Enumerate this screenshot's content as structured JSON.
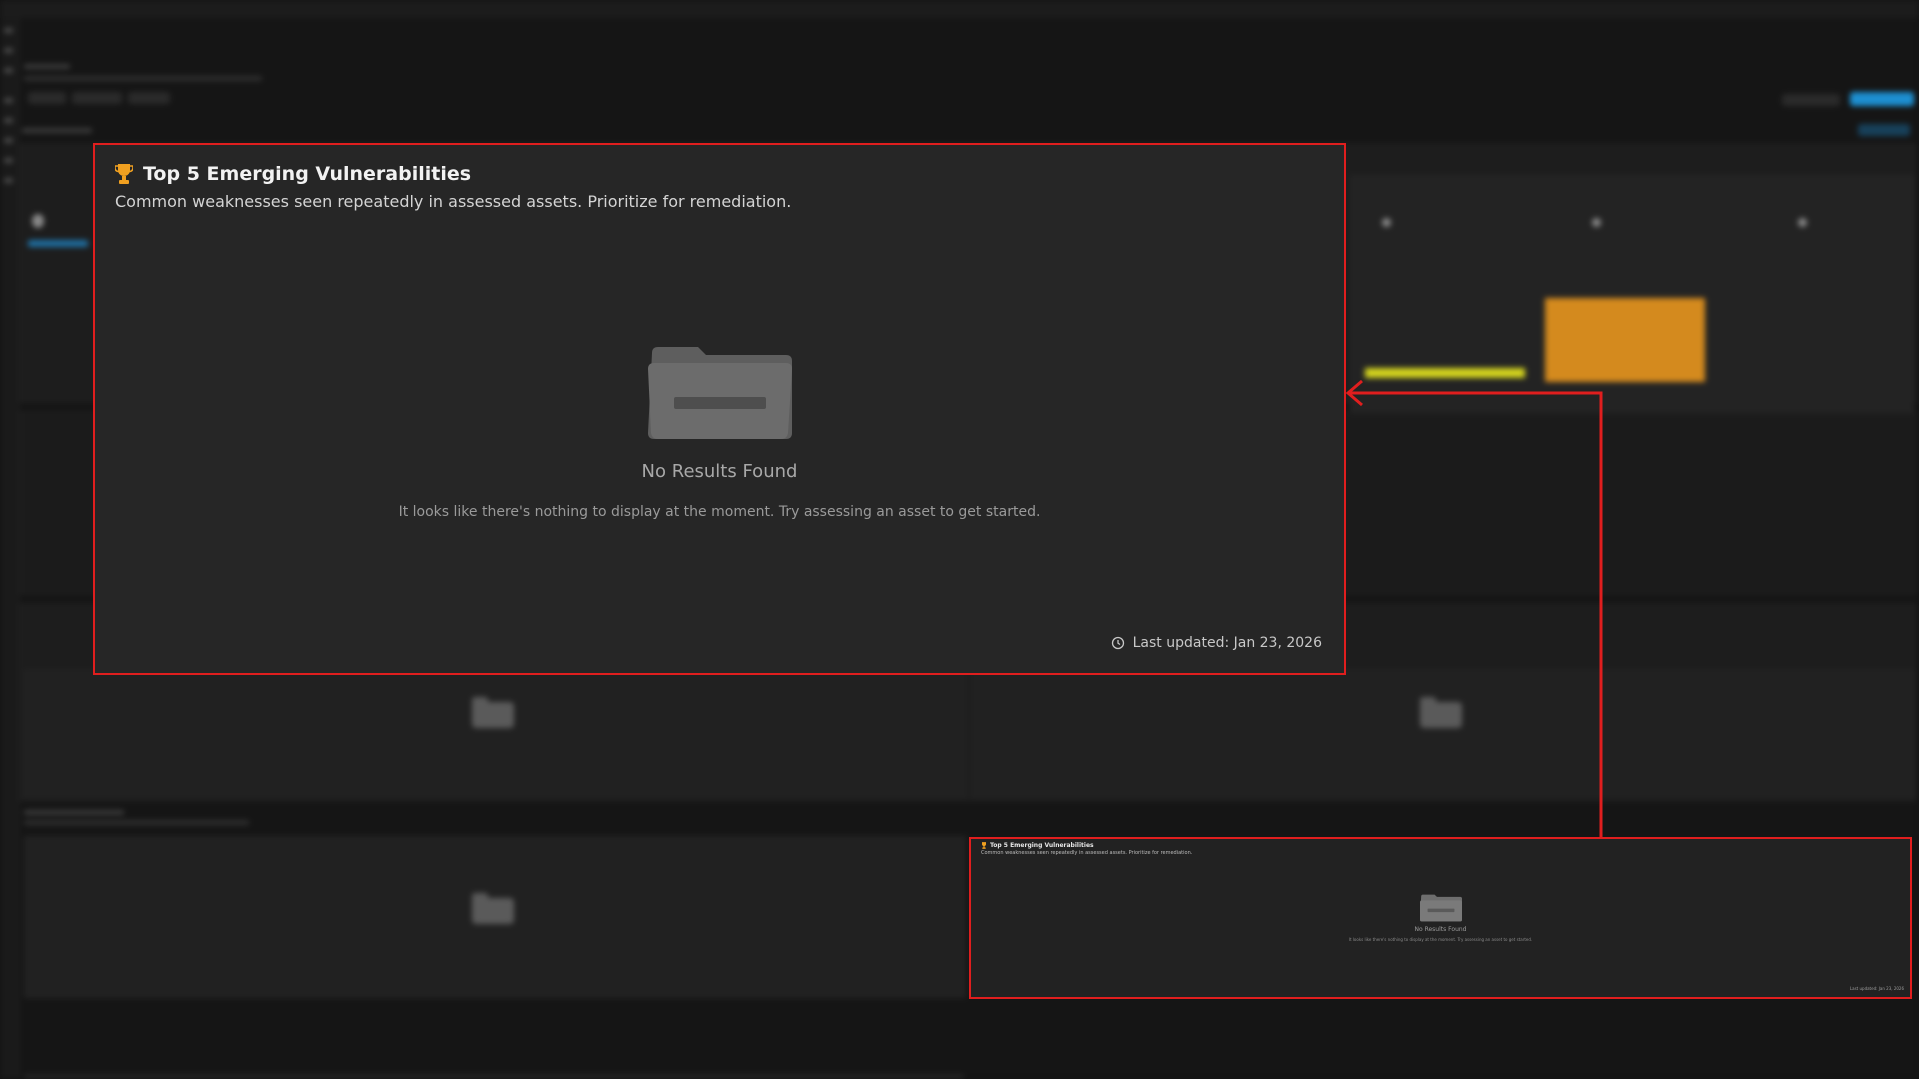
{
  "card": {
    "title": "Top 5 Emerging Vulnerabilities",
    "subtitle": "Common weaknesses seen repeatedly in assessed assets. Prioritize for remediation.",
    "empty_title": "No Results Found",
    "empty_desc": "It looks like there's nothing to display at the moment. Try assessing an asset to get started.",
    "last_updated": "Last updated: Jan 23, 2026",
    "trophy_icon": "trophy-icon",
    "folder_icon": "folder-icon",
    "clock_icon": "clock-icon"
  },
  "colors": {
    "highlight": "#e01e1e",
    "trophy": "#f0a020",
    "card_bg": "#262626",
    "bar_yellow": "#d4d41e",
    "bar_orange": "#d48a1e"
  }
}
